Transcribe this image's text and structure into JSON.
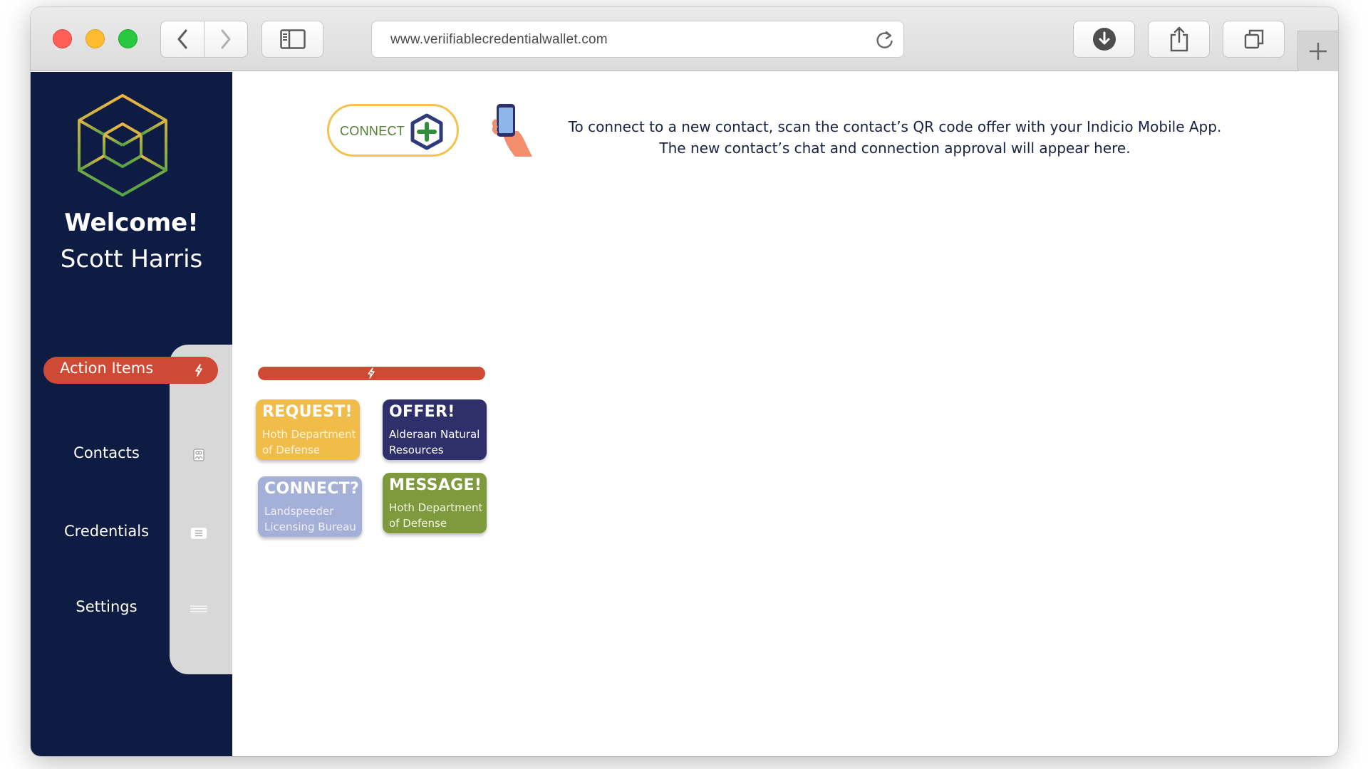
{
  "browser": {
    "url": "www.veriifiablecredentialwallet.com"
  },
  "sidebar": {
    "welcome": "Welcome!",
    "user_name": "Scott Harris",
    "items": [
      {
        "label": "Action Items",
        "icon": "lightning-bolt-icon",
        "active": true
      },
      {
        "label": "Contacts",
        "icon": "contacts-icon",
        "active": false
      },
      {
        "label": "Credentials",
        "icon": "credential-card-icon",
        "active": false
      },
      {
        "label": "Settings",
        "icon": "settings-lines-icon",
        "active": false
      }
    ]
  },
  "main": {
    "connect_button_label": "CONNECT",
    "instructions_line1": "To connect to a new contact, scan the contact’s QR code offer with your Indicio Mobile App.",
    "instructions_line2": "The new contact’s chat and connection approval will appear here.",
    "action_cards": [
      {
        "title": "REQUEST!",
        "subtitle": "Hoth Department of Defense",
        "color": "#f0bd4a"
      },
      {
        "title": "OFFER!",
        "subtitle": "Alderaan Natural Resources",
        "color": "#2e2f6b"
      },
      {
        "title": "CONNECT?",
        "subtitle": "Landspeeder Licensing Bureau",
        "color": "#a4b0d8"
      },
      {
        "title": "MESSAGE!",
        "subtitle": "Hoth Department of Defense",
        "color": "#7e9a3c"
      }
    ]
  },
  "colors": {
    "sidebar_bg": "#0e1c44",
    "accent_red": "#cf4a34",
    "connect_border": "#f2c44f"
  }
}
